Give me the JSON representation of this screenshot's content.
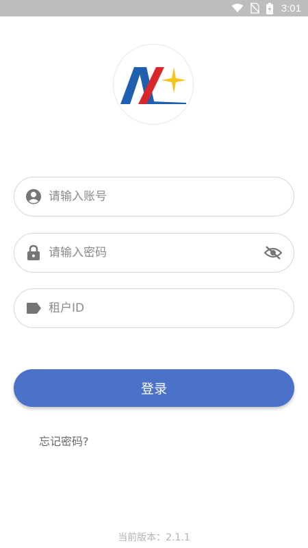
{
  "status_bar": {
    "time": "3:01",
    "icons": [
      "wifi-icon",
      "no-sim-icon",
      "battery-charging-icon"
    ]
  },
  "logo": {
    "icon": "company-logo",
    "colors": {
      "blue": "#1f5fb0",
      "red": "#d9262b",
      "star": "#f6c21c"
    }
  },
  "form": {
    "account": {
      "placeholder": "请输入账号",
      "value": "",
      "icon": "user-circle-icon"
    },
    "password": {
      "placeholder": "请输入密码",
      "value": "",
      "icon": "lock-icon",
      "toggle_icon": "eye-off-icon"
    },
    "tenant": {
      "placeholder": "租户ID",
      "value": "",
      "icon": "tag-icon"
    }
  },
  "login_button": {
    "label": "登录",
    "color": "#4a72c8"
  },
  "forgot_password": "忘记密码?",
  "version": "当前版本：2.1.1"
}
